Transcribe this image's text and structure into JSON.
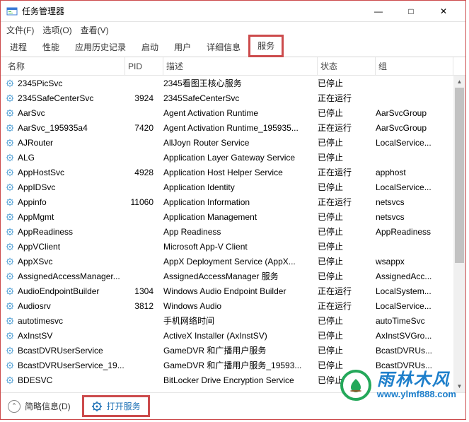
{
  "window": {
    "title": "任务管理器",
    "btn_min": "—",
    "btn_max": "□",
    "btn_close": "✕"
  },
  "menu": {
    "file": "文件(F)",
    "options": "选项(O)",
    "view": "查看(V)"
  },
  "tabs": {
    "t0": "进程",
    "t1": "性能",
    "t2": "应用历史记录",
    "t3": "启动",
    "t4": "用户",
    "t5": "详细信息",
    "t6": "服务"
  },
  "columns": {
    "name": "名称",
    "pid": "PID",
    "desc": "描述",
    "status": "状态",
    "group": "组"
  },
  "rows": [
    {
      "name": "2345PicSvc",
      "pid": "",
      "desc": "2345看图王核心服务",
      "status": "已停止",
      "group": ""
    },
    {
      "name": "2345SafeCenterSvc",
      "pid": "3924",
      "desc": "2345SafeCenterSvc",
      "status": "正在运行",
      "group": ""
    },
    {
      "name": "AarSvc",
      "pid": "",
      "desc": "Agent Activation Runtime",
      "status": "已停止",
      "group": "AarSvcGroup"
    },
    {
      "name": "AarSvc_195935a4",
      "pid": "7420",
      "desc": "Agent Activation Runtime_195935...",
      "status": "正在运行",
      "group": "AarSvcGroup"
    },
    {
      "name": "AJRouter",
      "pid": "",
      "desc": "AllJoyn Router Service",
      "status": "已停止",
      "group": "LocalService..."
    },
    {
      "name": "ALG",
      "pid": "",
      "desc": "Application Layer Gateway Service",
      "status": "已停止",
      "group": ""
    },
    {
      "name": "AppHostSvc",
      "pid": "4928",
      "desc": "Application Host Helper Service",
      "status": "正在运行",
      "group": "apphost"
    },
    {
      "name": "AppIDSvc",
      "pid": "",
      "desc": "Application Identity",
      "status": "已停止",
      "group": "LocalService..."
    },
    {
      "name": "Appinfo",
      "pid": "11060",
      "desc": "Application Information",
      "status": "正在运行",
      "group": "netsvcs"
    },
    {
      "name": "AppMgmt",
      "pid": "",
      "desc": "Application Management",
      "status": "已停止",
      "group": "netsvcs"
    },
    {
      "name": "AppReadiness",
      "pid": "",
      "desc": "App Readiness",
      "status": "已停止",
      "group": "AppReadiness"
    },
    {
      "name": "AppVClient",
      "pid": "",
      "desc": "Microsoft App-V Client",
      "status": "已停止",
      "group": ""
    },
    {
      "name": "AppXSvc",
      "pid": "",
      "desc": "AppX Deployment Service (AppX...",
      "status": "已停止",
      "group": "wsappx"
    },
    {
      "name": "AssignedAccessManager...",
      "pid": "",
      "desc": "AssignedAccessManager 服务",
      "status": "已停止",
      "group": "AssignedAcc..."
    },
    {
      "name": "AudioEndpointBuilder",
      "pid": "1304",
      "desc": "Windows Audio Endpoint Builder",
      "status": "正在运行",
      "group": "LocalSystem..."
    },
    {
      "name": "Audiosrv",
      "pid": "3812",
      "desc": "Windows Audio",
      "status": "正在运行",
      "group": "LocalService..."
    },
    {
      "name": "autotimesvc",
      "pid": "",
      "desc": "手机网络时间",
      "status": "已停止",
      "group": "autoTimeSvc"
    },
    {
      "name": "AxInstSV",
      "pid": "",
      "desc": "ActiveX Installer (AxInstSV)",
      "status": "已停止",
      "group": "AxInstSVGro..."
    },
    {
      "name": "BcastDVRUserService",
      "pid": "",
      "desc": "GameDVR 和广播用户服务",
      "status": "已停止",
      "group": "BcastDVRUs..."
    },
    {
      "name": "BcastDVRUserService_19...",
      "pid": "",
      "desc": "GameDVR 和广播用户服务_19593...",
      "status": "已停止",
      "group": "BcastDVRUs..."
    },
    {
      "name": "BDESVC",
      "pid": "",
      "desc": "BitLocker Drive Encryption Service",
      "status": "已停止",
      "group": ""
    }
  ],
  "status": {
    "collapse": "简略信息(D)",
    "open": "打开服务"
  },
  "watermark": {
    "brand": "雨林木风",
    "url": "www.ylmf888.com"
  }
}
